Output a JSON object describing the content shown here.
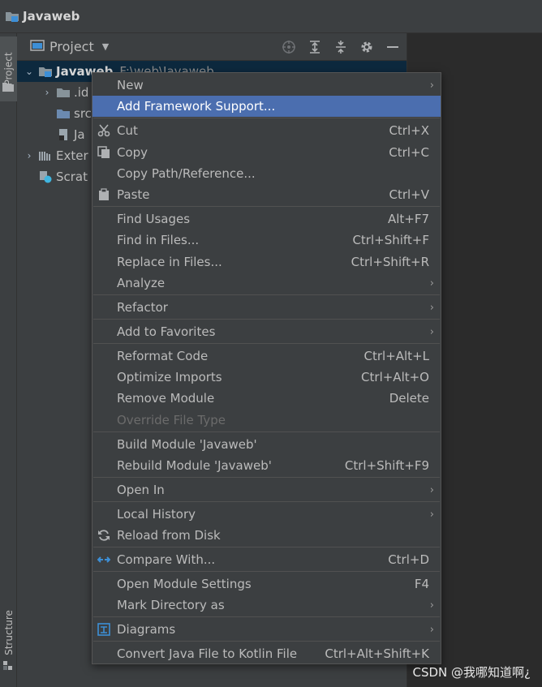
{
  "window": {
    "title": "Javaweb"
  },
  "left_strip": {
    "project_tab": "Project",
    "structure_tab": "Structure"
  },
  "project_panel": {
    "title": "Project",
    "tools": [
      "locate-icon",
      "expand-all-icon",
      "collapse-all-icon",
      "gear-icon",
      "minimize-icon"
    ]
  },
  "tree": [
    {
      "label": "Javaweb",
      "path": "F:\\web\\Javaweb",
      "icon": "module-folder-icon",
      "expanded": true
    },
    {
      "label": ".id",
      "icon": "folder-icon"
    },
    {
      "label": "src",
      "icon": "folder-icon"
    },
    {
      "label": "Ja",
      "icon": "iml-file-icon"
    },
    {
      "label": "Exter",
      "icon": "library-icon"
    },
    {
      "label": "Scrat",
      "icon": "scratch-icon"
    }
  ],
  "context_menu": {
    "items": [
      {
        "label": "New",
        "shortcut": "",
        "submenu": true
      },
      {
        "label": "Add Framework Support...",
        "shortcut": "",
        "highlight": true
      },
      {
        "label": "Cut",
        "shortcut": "Ctrl+X",
        "icon": "scissors-icon"
      },
      {
        "label": "Copy",
        "shortcut": "Ctrl+C",
        "icon": "copy-icon"
      },
      {
        "label": "Copy Path/Reference...",
        "shortcut": ""
      },
      {
        "label": "Paste",
        "shortcut": "Ctrl+V",
        "icon": "clipboard-icon"
      },
      {
        "label": "Find Usages",
        "shortcut": "Alt+F7"
      },
      {
        "label": "Find in Files...",
        "shortcut": "Ctrl+Shift+F"
      },
      {
        "label": "Replace in Files...",
        "shortcut": "Ctrl+Shift+R"
      },
      {
        "label": "Analyze",
        "shortcut": "",
        "submenu": true
      },
      {
        "label": "Refactor",
        "shortcut": "",
        "submenu": true
      },
      {
        "label": "Add to Favorites",
        "shortcut": "",
        "submenu": true
      },
      {
        "label": "Reformat Code",
        "shortcut": "Ctrl+Alt+L"
      },
      {
        "label": "Optimize Imports",
        "shortcut": "Ctrl+Alt+O"
      },
      {
        "label": "Remove Module",
        "shortcut": "Delete"
      },
      {
        "label": "Override File Type",
        "shortcut": "",
        "disabled": true
      },
      {
        "label": "Build Module 'Javaweb'",
        "shortcut": ""
      },
      {
        "label": "Rebuild Module 'Javaweb'",
        "shortcut": "Ctrl+Shift+F9"
      },
      {
        "label": "Open In",
        "shortcut": "",
        "submenu": true
      },
      {
        "label": "Local History",
        "shortcut": "",
        "submenu": true
      },
      {
        "label": "Reload from Disk",
        "shortcut": "",
        "icon": "reload-icon"
      },
      {
        "label": "Compare With...",
        "shortcut": "Ctrl+D",
        "icon": "compare-icon"
      },
      {
        "label": "Open Module Settings",
        "shortcut": "F4"
      },
      {
        "label": "Mark Directory as",
        "shortcut": "",
        "submenu": true
      },
      {
        "label": "Diagrams",
        "shortcut": "",
        "submenu": true,
        "icon": "diagram-icon"
      },
      {
        "label": "Convert Java File to Kotlin File",
        "shortcut": "Ctrl+Alt+Shift+K"
      }
    ],
    "submenu_glyph": "›"
  },
  "watermark": "CSDN @我哪知道啊¿",
  "colors": {
    "highlight": "#4b6eaf",
    "panel": "#3c3f41",
    "editor": "#2b2b2b",
    "text": "#bbbbbb"
  }
}
